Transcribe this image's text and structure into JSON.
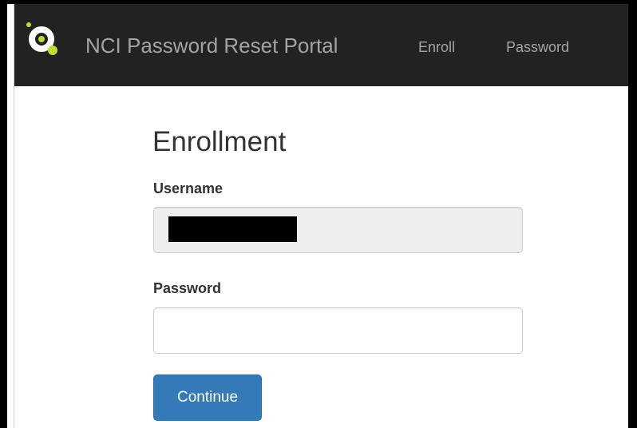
{
  "navbar": {
    "brand": "NCI Password Reset Portal",
    "links": [
      {
        "label": "Enroll"
      },
      {
        "label": "Password"
      }
    ],
    "logo_icon": "ring-dots-logo-icon",
    "background_color": "#222222",
    "link_color": "#a4a4a4",
    "logo_accent_color": "#b8e02c"
  },
  "form": {
    "title": "Enrollment",
    "username_label": "Username",
    "username_value": "",
    "password_label": "Password",
    "password_value": "",
    "submit_label": "Continue",
    "button_color": "#337ab7"
  }
}
